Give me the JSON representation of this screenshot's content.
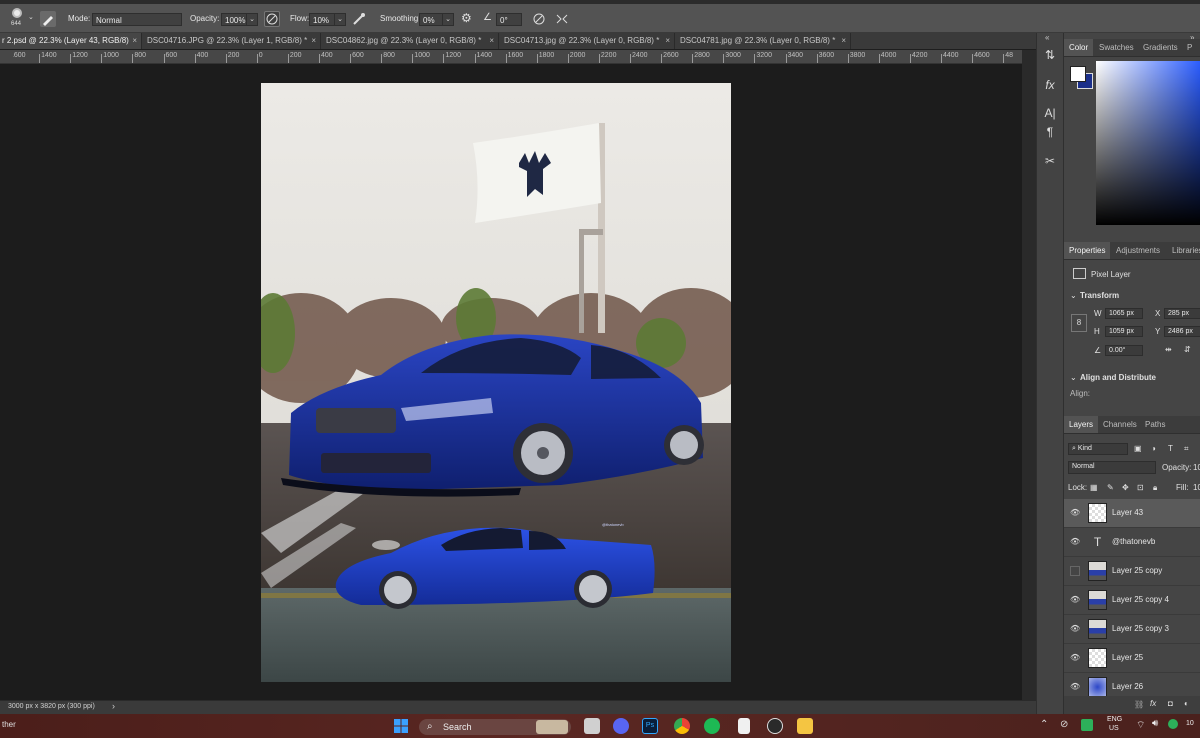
{
  "options_bar": {
    "brush_size": "644",
    "mode_label": "Mode:",
    "mode_value": "Normal",
    "opacity_label": "Opacity:",
    "opacity_value": "100%",
    "flow_label": "Flow:",
    "flow_value": "10%",
    "smoothing_label": "Smoothing:",
    "smoothing_value": "0%",
    "angle_value": "0°"
  },
  "tabs": [
    {
      "label": "r 2.psd @ 22.3% (Layer 43, RGB/8)",
      "close": "×"
    },
    {
      "label": "DSC04716.JPG @ 22.3% (Layer 1, RGB/8) *",
      "close": "×"
    },
    {
      "label": "DSC04862.jpg @ 22.3% (Layer 0, RGB/8) *",
      "close": "×"
    },
    {
      "label": "DSC04713.jpg @ 22.3% (Layer 0, RGB/8) *",
      "close": "×"
    },
    {
      "label": "DSC04781.jpg @ 22.3% (Layer 0, RGB/8) *",
      "close": "×"
    }
  ],
  "ruler_labels": [
    "1600",
    "1400",
    "1200",
    "1000",
    "800",
    "600",
    "400",
    "200",
    "0",
    "200",
    "400",
    "600",
    "800",
    "1000",
    "1200",
    "1400",
    "1600",
    "1800",
    "2000",
    "2200",
    "2400",
    "2600",
    "2800",
    "3000",
    "3200",
    "3400",
    "3600",
    "3800",
    "4000",
    "4200",
    "4400",
    "4600",
    "48"
  ],
  "canvas": {
    "image_overlay_text": "@thatonevb"
  },
  "status": {
    "doc_size": "3000 px x 3820 px (300 ppi)",
    "arrow": "›"
  },
  "color_panel": {
    "tabs": [
      "Color",
      "Swatches",
      "Gradients",
      "P"
    ],
    "foreground": "#ffffff",
    "background": "#1b2f8a",
    "picker_hue": "#2a5cff"
  },
  "properties_panel": {
    "tabs": [
      "Properties",
      "Adjustments",
      "Libraries"
    ],
    "kind": "Pixel Layer",
    "transform_label": "Transform",
    "w_label": "W",
    "w_value": "1065 px",
    "x_label": "X",
    "x_value": "285 px",
    "h_label": "H",
    "h_value": "1059 px",
    "y_label": "Y",
    "y_value": "2486 px",
    "angle_value": "0.00°",
    "align_label": "Align and Distribute",
    "align_sub": "Align:"
  },
  "layers_panel": {
    "tabs": [
      "Layers",
      "Channels",
      "Paths"
    ],
    "kind_value": "Kind",
    "blend_value": "Normal",
    "opacity_label": "Opacity:",
    "opacity_value": "10",
    "lock_label": "Lock:",
    "fill_label": "Fill:",
    "fill_value": "10",
    "layers": [
      {
        "name": "Layer 43",
        "visible": true,
        "selected": true,
        "thumb": "transparent"
      },
      {
        "name": "@thatonevb",
        "visible": true,
        "selected": false,
        "thumb": "text"
      },
      {
        "name": "Layer 25 copy",
        "visible": false,
        "selected": false,
        "thumb": "car"
      },
      {
        "name": "Layer 25 copy 4",
        "visible": true,
        "selected": false,
        "thumb": "car"
      },
      {
        "name": "Layer 25 copy 3",
        "visible": true,
        "selected": false,
        "thumb": "car"
      },
      {
        "name": "Layer 25",
        "visible": true,
        "selected": false,
        "thumb": "transparent"
      },
      {
        "name": "Layer 26",
        "visible": true,
        "selected": false,
        "thumb": "blue"
      }
    ]
  },
  "taskbar": {
    "left_text": "ther",
    "search_label": "Search",
    "tray_lang": "ENG",
    "tray_region": "US",
    "tray_time": "10"
  }
}
